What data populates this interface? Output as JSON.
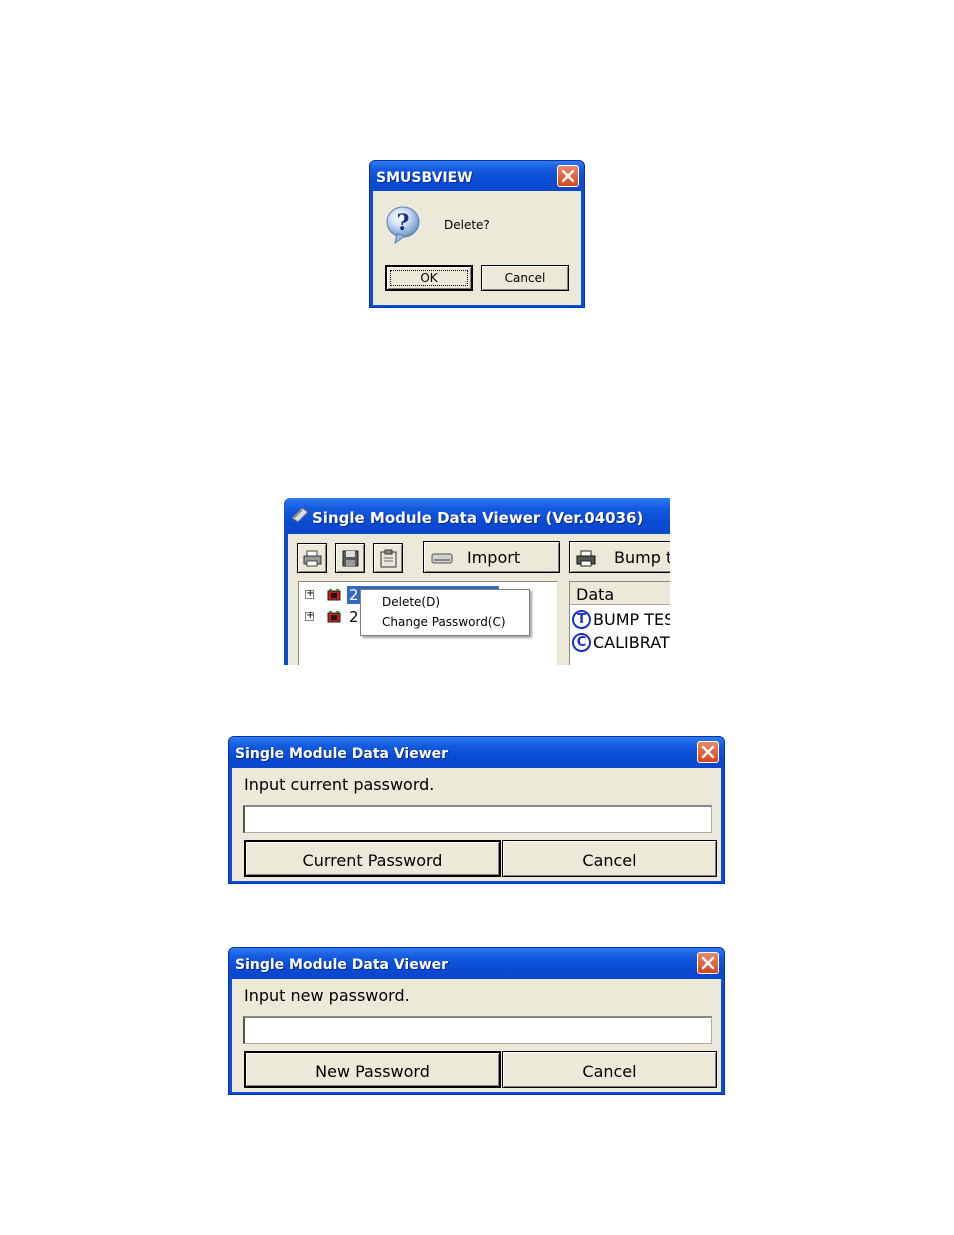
{
  "delete_dialog": {
    "title": "SMUSBVIEW",
    "message": "Delete?",
    "ok_label": "OK",
    "cancel_label": "Cancel",
    "icon": "question-icon"
  },
  "main_window": {
    "title": "Single Module Data Viewer (Ver.04036)",
    "toolbar": {
      "print_icon": "printer-icon",
      "save_icon": "floppy-disk-icon",
      "clipboard_icon": "clipboard-icon",
      "import_label": "Import",
      "bump_label": "Bump t"
    },
    "tree": {
      "items": [
        {
          "label": "2",
          "expander": "+"
        },
        {
          "label": "2",
          "expander": "+"
        }
      ]
    },
    "context_menu": {
      "items": [
        {
          "label": "Delete(D)"
        },
        {
          "label": "Change Password(C)"
        }
      ]
    },
    "data_panel": {
      "header": "Data",
      "rows": [
        {
          "badge": "T",
          "label": "BUMP TES"
        },
        {
          "badge": "C",
          "label": "CALIBRAT"
        }
      ]
    }
  },
  "current_password_dialog": {
    "title": "Single Module Data Viewer",
    "prompt": "Input current password.",
    "input_value": "",
    "ok_label": "Current Password",
    "cancel_label": "Cancel"
  },
  "new_password_dialog": {
    "title": "Single Module Data Viewer",
    "prompt": "Input new password.",
    "input_value": "",
    "ok_label": "New Password",
    "cancel_label": "Cancel"
  },
  "colors": {
    "xp_title_blue": "#0a4ad2",
    "dialog_face": "#ece9d8",
    "close_red": "#d2461f",
    "tree_selection": "#316ac5"
  }
}
